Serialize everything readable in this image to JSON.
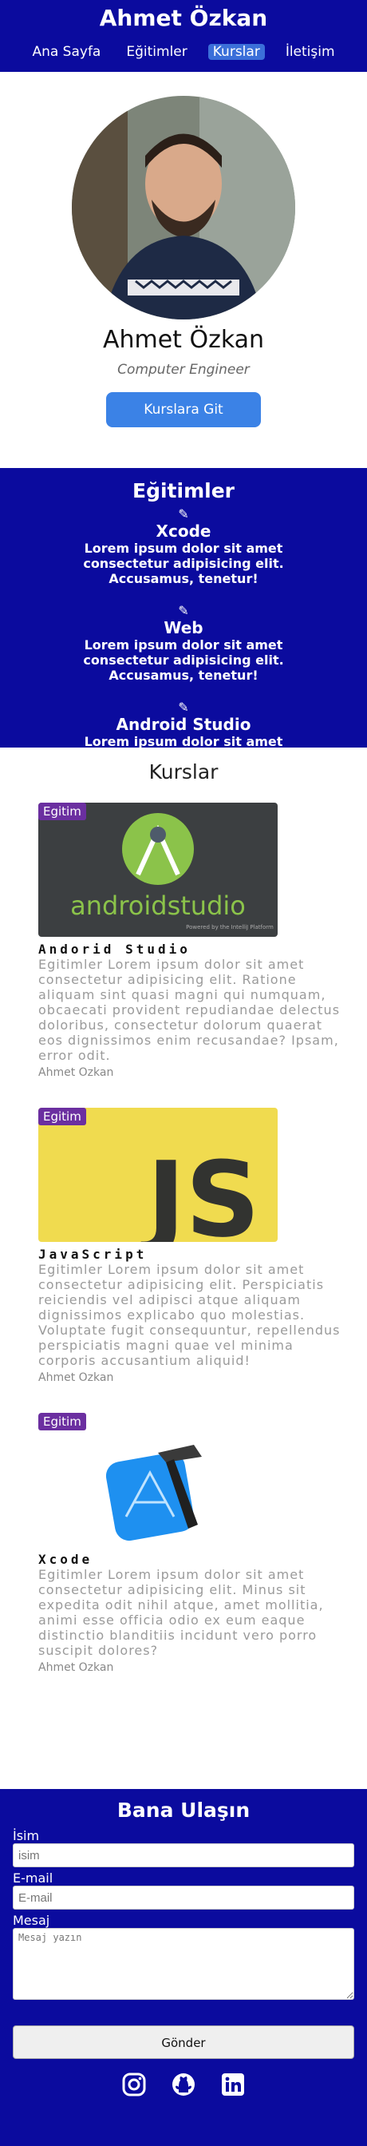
{
  "header": {
    "title": "Ahmet Özkan",
    "nav": [
      "Ana Sayfa",
      "Eğitimler",
      "Kurslar",
      "İletişim"
    ],
    "active_index": 2
  },
  "hero": {
    "name": "Ahmet Özkan",
    "role": "Computer Engineer",
    "button_label": "Kurslara Git"
  },
  "education": {
    "title": "Eğitimler",
    "items": [
      {
        "name": "Xcode",
        "text": "Lorem ipsum dolor sit amet consectetur adipisicing elit. Accusamus, tenetur!"
      },
      {
        "name": "Web",
        "text": "Lorem ipsum dolor sit amet consectetur adipisicing elit. Accusamus, tenetur!"
      },
      {
        "name": "Android Studio",
        "text": "Lorem ipsum dolor sit amet consectetur adipisicing elit. Accusamus, tenetur!"
      }
    ]
  },
  "courses": {
    "title": "Kurslar",
    "badge": "Egitim",
    "items": [
      {
        "name": "Andorid Studio",
        "desc": "Egitimler Lorem ipsum dolor sit amet consectetur adipisicing elit. Ratione aliquam sint quasi magni qui numquam, obcaecati provident repudiandae delectus doloribus, consectetur dolorum quaerat eos dignissimos enim recusandae? Ipsam, error odit.",
        "author": "Ahmet Ozkan",
        "logo_text": "androidstudio",
        "logo_sub": "Powered by the IntelliJ Platform"
      },
      {
        "name": "JavaScript",
        "desc": "Egitimler Lorem ipsum dolor sit amet consectetur adipisicing elit. Perspiciatis reiciendis vel adipisci atque aliquam dignissimos explicabo quo molestias. Voluptate fugit consequuntur, repellendus perspiciatis magni quae vel minima corporis accusantium aliquid!",
        "author": "Ahmet Ozkan",
        "logo_text": "JS"
      },
      {
        "name": "Xcode",
        "desc": "Egitimler Lorem ipsum dolor sit amet consectetur adipisicing elit. Minus sit expedita odit nihil atque, amet mollitia, animi esse officia odio ex eum eaque distinctio blanditiis incidunt vero porro suscipit dolores?",
        "author": "Ahmet Ozkan"
      }
    ]
  },
  "contact": {
    "title": "Bana Ulaşın",
    "name_label": "İsim",
    "name_placeholder": "isim",
    "email_label": "E-mail",
    "email_placeholder": "E-mail",
    "message_label": "Mesaj",
    "message_placeholder": "Mesaj yazın",
    "submit_label": "Gönder",
    "socials": [
      "instagram-icon",
      "github-icon",
      "linkedin-icon"
    ]
  },
  "colors": {
    "navy": "#0b0b9e",
    "accent": "#3b82e6",
    "badge": "#6b2fa0"
  }
}
